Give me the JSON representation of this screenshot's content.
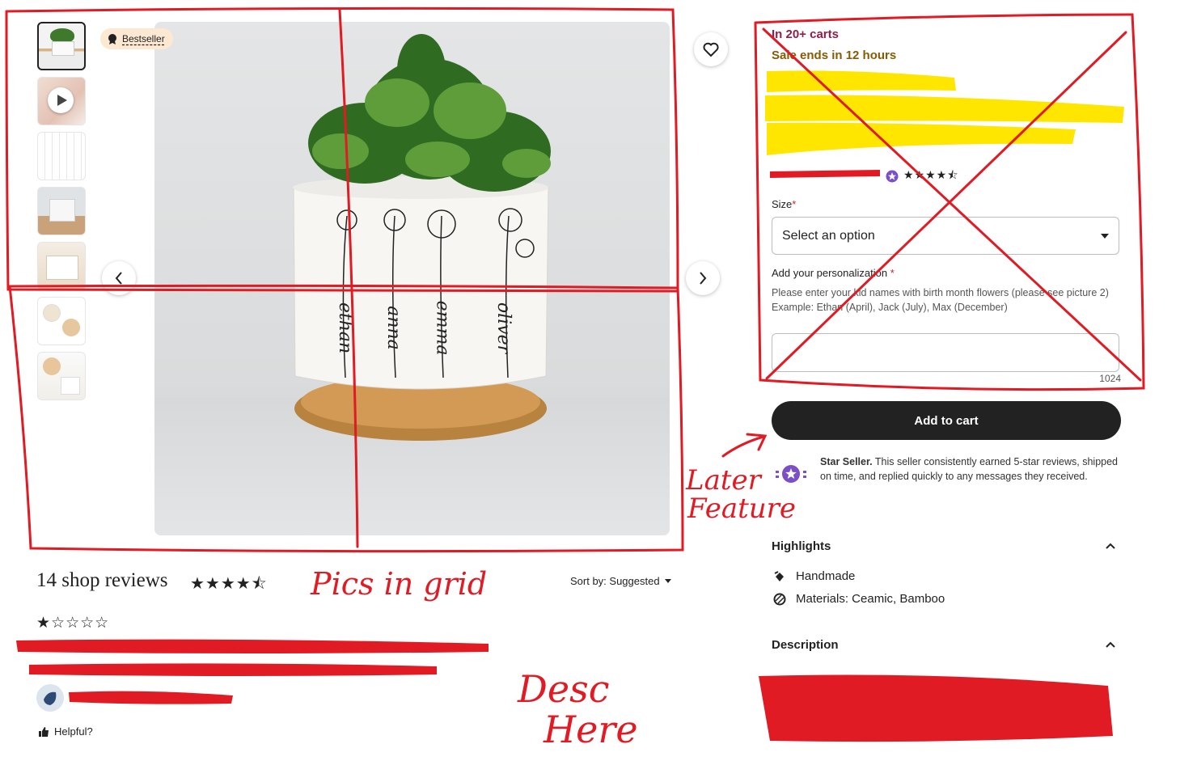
{
  "gallery": {
    "badge": "Bestseller",
    "thumbnails": [
      "photo-1",
      "video",
      "chart",
      "photo-4",
      "photo-5",
      "photo-6",
      "photo-7"
    ]
  },
  "listing": {
    "carts": "In 20+ carts",
    "sale": "Sale ends in 12 hours",
    "rating_stars": "★★★★⯪",
    "size_label": "Size",
    "required_mark": "*",
    "size_placeholder": "Select an option",
    "personalization_label": "Add your personalization",
    "personalization_hint_1": "Please enter your kid names with birth month flowers (please see picture 2)",
    "personalization_hint_2": "Example: Ethan (April), Jack (July), Max (December)",
    "char_count": "1024",
    "add_to_cart": "Add to cart"
  },
  "star_seller": {
    "title": "Star Seller.",
    "text": " This seller consistently earned 5-star reviews, shipped on time, and replied quickly to any messages they received."
  },
  "highlights": {
    "title": "Highlights",
    "items": [
      "Handmade",
      "Materials: Ceamic, Bamboo"
    ]
  },
  "description": {
    "title": "Description"
  },
  "reviews": {
    "title": "14 shop reviews",
    "stars": "★★★★⯪",
    "sort_label": "Sort by: Suggested",
    "review_stars": "★☆☆☆☆",
    "helpful": "Helpful?"
  },
  "pot_names": [
    "ethan",
    "anna",
    "emma",
    "oliver"
  ],
  "annotations": {
    "later_feature": [
      "Later",
      "Feature"
    ],
    "pics_in_grid": "Pics in grid",
    "desc_here": [
      "Desc",
      "Here"
    ],
    "ink_color": "#e01b24",
    "highlight_color": "#ffe600"
  }
}
